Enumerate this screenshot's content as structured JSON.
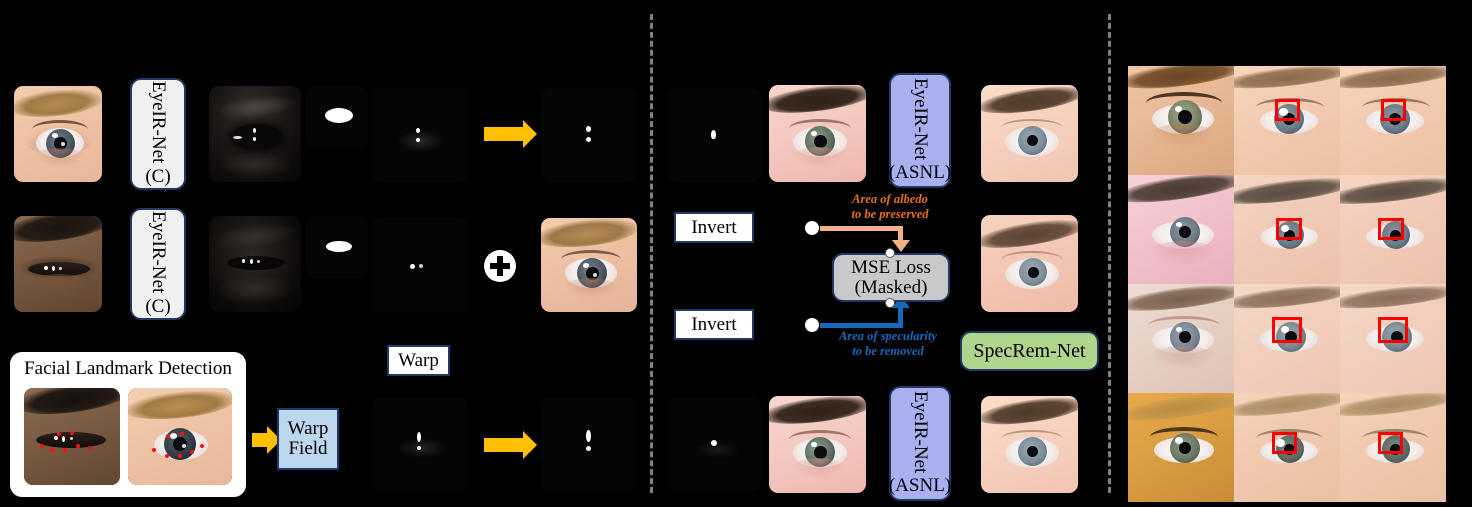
{
  "figure": {
    "background": "#000000",
    "accent_arrow": "#FFC000",
    "divider_color": "#808080",
    "box_border": "#1F3864",
    "red_box": "#FF0000"
  },
  "panels": {
    "left": {
      "name": "training-pipeline",
      "rows": [
        {
          "id": "row-1",
          "input_label": "eye-crop-light-skin",
          "net": {
            "label_main": "EyeIR-Net",
            "label_sub": "(C)",
            "style": "gray"
          },
          "outputs": [
            "shading-map",
            "mask-lobe",
            "specular-map-raw"
          ],
          "arrow": "warp-arrow",
          "final": "specular-map-warped"
        },
        {
          "id": "row-2",
          "input_label": "eye-crop-dark-skin",
          "net": {
            "label_main": "EyeIR-Net",
            "label_sub": "(C)",
            "style": "gray"
          },
          "outputs": [
            "shading-map",
            "mask-lobe",
            "specular-map-raw"
          ],
          "combine": "plus-operator",
          "final": "composited-eye"
        },
        {
          "id": "row-3",
          "panel_title": "Facial Landmark Detection",
          "warp_field": {
            "label_line1": "Warp",
            "label_line2": "Field",
            "style": "lblue"
          },
          "outputs": [
            "warp-source-map"
          ],
          "arrow": "warp-arrow",
          "final": "warp-target-map"
        }
      ],
      "warp_label": "Warp"
    },
    "middle": {
      "name": "loss-supervision",
      "invert_buttons": [
        "Invert",
        "Invert"
      ],
      "nets": [
        {
          "label_main": "EyeIR-Net",
          "label_sub": "(ASNL)",
          "style": "blue"
        },
        {
          "label_main": "EyeIR-Net",
          "label_sub": "(ASNL)",
          "style": "blue"
        }
      ],
      "specrem_net": {
        "label": "SpecRem-Net",
        "style": "green"
      },
      "loss_box": {
        "line1": "MSE Loss",
        "line2": "(Masked)",
        "style": "silver"
      },
      "annotations": [
        {
          "id": "albedo-annotation",
          "line1": "Area of albedo",
          "line2": "to be preserved",
          "color": "#E8711A"
        },
        {
          "id": "specularity-annotation",
          "line1": "Area of specularity",
          "line2": "to be removed",
          "color": "#1668B8"
        }
      ]
    },
    "right": {
      "name": "qualitative-results-grid",
      "columns": 3,
      "rows": 4,
      "cells": [
        {
          "row": 1,
          "col": 1,
          "label": "input-eye-warm-tone",
          "highlight": false
        },
        {
          "row": 1,
          "col": 2,
          "label": "result-with-specular",
          "highlight": true
        },
        {
          "row": 1,
          "col": 3,
          "label": "result-specular-removed",
          "highlight": true
        },
        {
          "row": 2,
          "col": 1,
          "label": "input-eye-pink-tone",
          "highlight": false
        },
        {
          "row": 2,
          "col": 2,
          "label": "result-with-specular",
          "highlight": true
        },
        {
          "row": 2,
          "col": 3,
          "label": "result-specular-removed",
          "highlight": true
        },
        {
          "row": 3,
          "col": 1,
          "label": "input-eye-neutral-tone",
          "highlight": false
        },
        {
          "row": 3,
          "col": 2,
          "label": "result-with-specular",
          "highlight": true
        },
        {
          "row": 3,
          "col": 3,
          "label": "result-specular-removed",
          "highlight": true
        },
        {
          "row": 4,
          "col": 1,
          "label": "input-eye-golden-tone",
          "highlight": false
        },
        {
          "row": 4,
          "col": 2,
          "label": "result-with-specular",
          "highlight": true
        },
        {
          "row": 4,
          "col": 3,
          "label": "result-specular-removed",
          "highlight": true
        }
      ]
    }
  }
}
